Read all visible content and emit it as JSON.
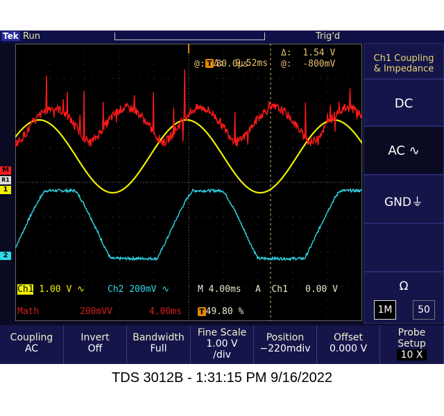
{
  "header": {
    "brand": "Tek",
    "run_state": "Run",
    "trigger_state": "Trig'd"
  },
  "cursor_readout": {
    "t_delta_label": "Δ:",
    "t_delta_value": "9.52ms",
    "t_at_label": "@:",
    "t_at_value": "80.0µs",
    "v_delta_label": "Δ:",
    "v_delta_value": "1.54 V",
    "v_at_label": "@:",
    "v_at_value": "-800mV"
  },
  "status": {
    "ch1_label": "Ch1",
    "ch1_scale": "1.00 V ∿",
    "ch2_label": "Ch2",
    "ch2_scale": "200mV ∿",
    "timebase": "M 4.00ms",
    "trig_source": "A  Ch1",
    "trig_level": "0.00 V",
    "math_label": "Math",
    "math_scale": "200mVV",
    "math_time": "4.00ms",
    "trig_pos": "49.80 %"
  },
  "markers": {
    "math": "M",
    "ref1": "R1",
    "ch1": "1",
    "ch2": "2"
  },
  "side_menu": {
    "title_line1": "Ch1 Coupling",
    "title_line2": "& Impedance",
    "dc": "DC",
    "ac": "AC ∿",
    "gnd": "GND⏚",
    "ohm": "Ω",
    "imp_1m": "1M",
    "imp_50": "50"
  },
  "bottom_menu": [
    {
      "label": "Coupling",
      "value": "AC"
    },
    {
      "label": "Invert",
      "value": "Off"
    },
    {
      "label": "Bandwidth",
      "value": "Full"
    },
    {
      "label": "Fine Scale",
      "value": "1.00 V\n/div"
    },
    {
      "label": "Position",
      "value": "−220mdiv"
    },
    {
      "label": "Offset",
      "value": "0.000 V"
    },
    {
      "label": "Probe\nSetup",
      "value": "10 X"
    }
  ],
  "caption": "TDS 3012B - 1:31:15 PM    9/16/2022",
  "colors": {
    "ch1": "#f0f000",
    "ch2": "#30d8e8",
    "math": "#ff1a1a",
    "grid": "#5a5a5a",
    "accent": "#e08a00"
  },
  "chart_data": {
    "type": "line",
    "series": [
      {
        "name": "Ch1",
        "color": "#f0f000",
        "shape": "sine",
        "period_ms": 17.0,
        "amplitude_div": 1.05,
        "offset_div": 0.75
      },
      {
        "name": "Ch2",
        "color": "#30d8e8",
        "shape": "clipped",
        "period_ms": 17.0,
        "amplitude_div": 1.45,
        "offset_div": -1.4
      },
      {
        "name": "Math",
        "color": "#ff1a1a",
        "shape": "rectified-noisy",
        "period_ms": 17.0,
        "amplitude_div": 1.0,
        "offset_div": 1.65
      }
    ],
    "x_range_ms": [
      0,
      40
    ],
    "y_range_div": [
      -4,
      4
    ],
    "divisions": {
      "x": 10,
      "y": 8
    },
    "grid": true
  }
}
